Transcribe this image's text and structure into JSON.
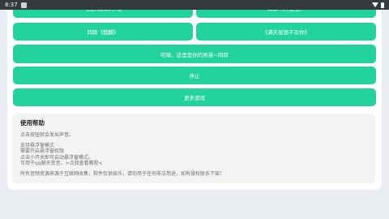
{
  "status_bar": {
    "time": "8:37"
  },
  "buttons": {
    "partial_left": "电话响别麻了哦",
    "partial_right": "四郎《开支线》",
    "row2_left": "四郎《麒麟》",
    "row2_right": "《满天星辰不及你》",
    "full1": "哎呦，这里是你的男孩~四郎",
    "stop": "停止",
    "more_games": "更多游戏"
  },
  "help": {
    "title": "使用帮助",
    "line1": "点击按钮就会发出声音。",
    "line2": "支持悬浮窗模式",
    "line3": "需要开启悬浮窗权限",
    "line4": "点击小开关即可启动悬浮窗模式。",
    "line5": "可用于qq聊天变音。>点我查看教程<",
    "line6": "所有音频资源来源于互联网收集，软件仅供娱乐，请勿用于任何非法用途，如有侵权联系下架！"
  },
  "colors": {
    "accent": "#22d39b",
    "statusbar": "#353a3f",
    "background": "#e9edf1"
  }
}
